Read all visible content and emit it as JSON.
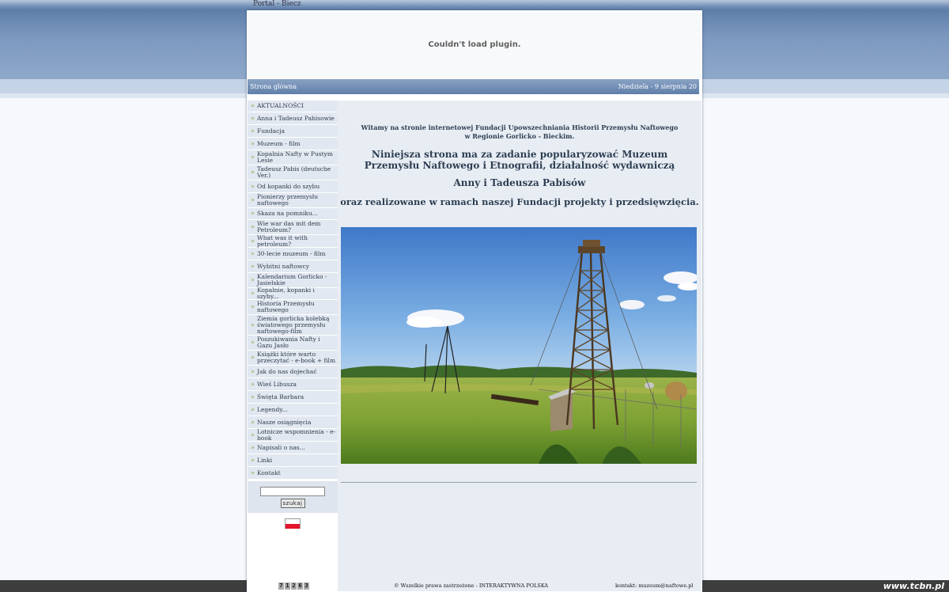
{
  "window_title": "Portal - Biecz",
  "plugin_message": "Couldn't load plugin.",
  "navbar": {
    "home": "Strona główna",
    "date": "Niedziela - 9 sierpnia 20"
  },
  "sidebar": {
    "items": [
      {
        "label": "AKTUALNOŚCI"
      },
      {
        "label": "Anna i Tadeusz Pabisowie"
      },
      {
        "label": "Fundacja"
      },
      {
        "label": "Muzeum - film"
      },
      {
        "label": "Kopalnia Nafty w Pustym Lesie"
      },
      {
        "label": "Tadeusz Pabis (deutsche Ver.)"
      },
      {
        "label": "Od kopanki do szybu"
      },
      {
        "label": "Pionierzy przemysłu naftowego"
      },
      {
        "label": "Skaza na pomniku..."
      },
      {
        "label": "Wie war das mit dem Petroleum?"
      },
      {
        "label": "What was it with petroleum?"
      },
      {
        "label": "30-lecie muzeum - film"
      },
      {
        "label": "Wybitni naftowcy"
      },
      {
        "label": "Kalendarium Gorlicko - Jasielskie"
      },
      {
        "label": "Kopalnie, kopanki i szyby..."
      },
      {
        "label": "Historia Przemysłu naftowego"
      },
      {
        "label": "Ziemia gorlicka kolebką światowego przemysłu naftowego-film"
      },
      {
        "label": "Poszukiwania Nafty i Gazu Jasło"
      },
      {
        "label": "Książki które warto przeczytać - e-book + film"
      },
      {
        "label": "Jak do nas dojechać"
      },
      {
        "label": "Wieś Libusza"
      },
      {
        "label": "Święta Barbara"
      },
      {
        "label": "Legendy..."
      },
      {
        "label": "Nasze osiągnięcia"
      },
      {
        "label": "Lotnicze wspomnienia - e-book"
      },
      {
        "label": "Napisali o nas..."
      },
      {
        "label": "Linki"
      },
      {
        "label": "Kontakt"
      }
    ],
    "search_button": "szukaj"
  },
  "content": {
    "welcome_line1": "Witamy na stronie internetowej Fundacji Upowszechniania Historii Przemysłu Naftowego",
    "welcome_line2": "w Regionie Gorlicko - Bieckim.",
    "mission": "Niniejsza strona ma za zadanie popularyzować Muzeum Przemysłu Naftowego i Etnografii,       działalność wydawniczą",
    "names": "Anny i Tadeusza Pabisów",
    "projects": "oraz realizowane w ramach naszej Fundacji projekty i przedsięwzięcia."
  },
  "footer": {
    "counter": [
      "7",
      "1",
      "2",
      "6",
      "3"
    ],
    "copyright": "© Wszelkie prawa zastrzeżone - INTERAKTYWNA POLSKA",
    "contact": "kontakt: muzeum@naftowe.pl"
  },
  "watermark": "www.tcbn.pl",
  "colors": {
    "header_blue": "#6f8db5",
    "menu_bg": "#e2e8f1",
    "content_bg": "#e8edf4",
    "text_dark": "#2d3e52"
  }
}
